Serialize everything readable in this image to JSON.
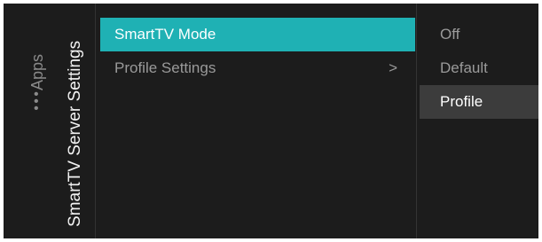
{
  "breadcrumb": {
    "parent": "Apps",
    "more_glyph": "⋮",
    "current": "SmartTV Server Settings"
  },
  "menu": {
    "items": [
      {
        "label": "SmartTV Mode",
        "selected": true
      },
      {
        "label": "Profile Settings",
        "chevron": ">"
      }
    ]
  },
  "options": {
    "items": [
      {
        "label": "Off"
      },
      {
        "label": "Default"
      },
      {
        "label": "Profile",
        "selected": true
      }
    ]
  },
  "colors": {
    "background": "#1c1c1c",
    "accent": "#1fb1b4",
    "option_highlight": "#3c3c3c"
  }
}
